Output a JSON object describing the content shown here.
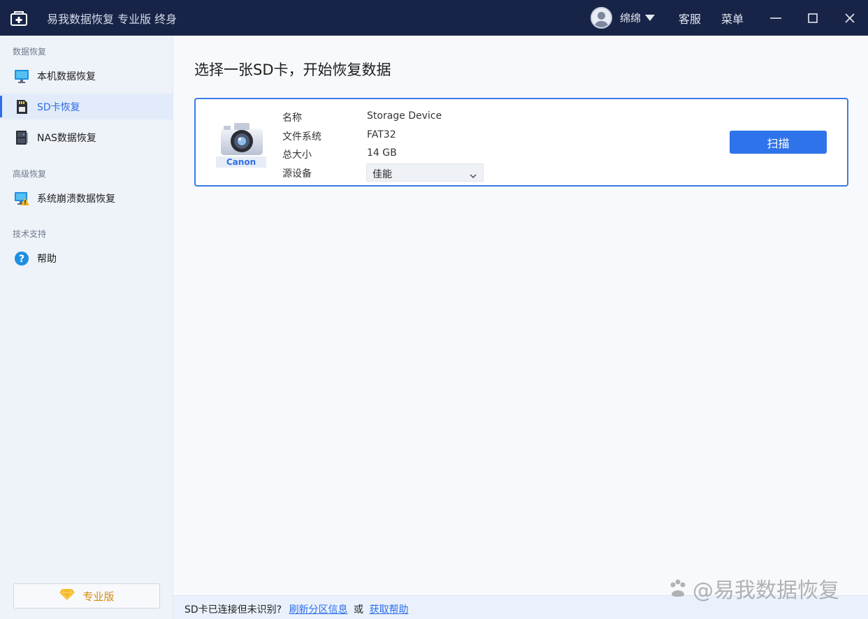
{
  "window": {
    "title": "易我数据恢复 专业版 终身",
    "user_name": "绵绵",
    "service_label": "客服",
    "menu_label": "菜单"
  },
  "sidebar": {
    "sections": [
      {
        "label": "数据恢复"
      },
      {
        "label": "高级恢复"
      },
      {
        "label": "技术支持"
      }
    ],
    "items": [
      {
        "label": "本机数据恢复",
        "icon": "monitor-icon",
        "active": false
      },
      {
        "label": "SD卡恢复",
        "icon": "sd-card-icon",
        "active": true
      },
      {
        "label": "NAS数据恢复",
        "icon": "nas-icon",
        "active": false
      },
      {
        "label": "系统崩溃数据恢复",
        "icon": "crash-warning-icon",
        "active": false
      },
      {
        "label": "帮助",
        "icon": "help-icon",
        "active": false
      }
    ],
    "pro_button_label": "专业版"
  },
  "main": {
    "title": "选择一张SD卡，开始恢复数据",
    "device": {
      "camera_brand": "Canon",
      "props": [
        {
          "key": "名称",
          "value": "Storage Device"
        },
        {
          "key": "文件系统",
          "value": "FAT32"
        },
        {
          "key": "总大小",
          "value": "14 GB"
        },
        {
          "key": "源设备",
          "value": "佳能"
        }
      ],
      "scan_label": "扫描"
    }
  },
  "footer": {
    "question": "SD卡已连接但未识别?",
    "link1": "刷新分区信息",
    "or": "或",
    "link2": "获取帮助"
  },
  "watermark": "@易我数据恢复",
  "colors": {
    "titlebar": "#182447",
    "accent": "#2e6ee6",
    "sidebar_bg": "#eef2f9",
    "main_bg": "#f7f9fc"
  }
}
